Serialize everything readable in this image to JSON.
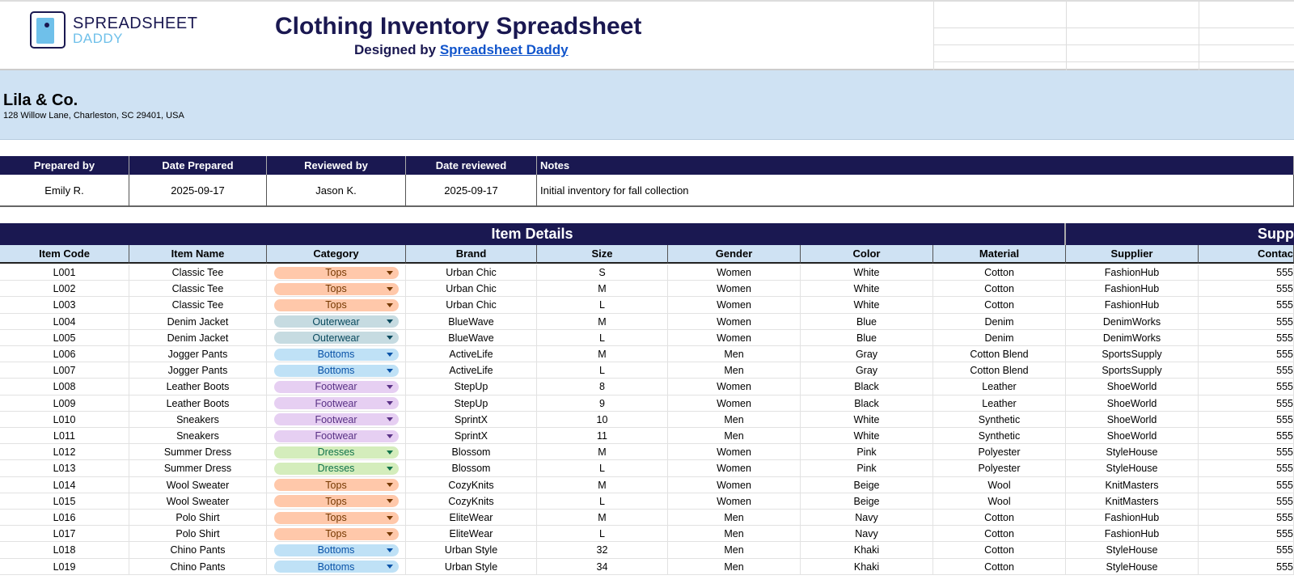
{
  "header": {
    "brand_line1": "SPREADSHEET",
    "brand_line2": "DADDY",
    "title": "Clothing Inventory Spreadsheet",
    "designed_by": "Designed by",
    "designer_link": "Spreadsheet Daddy"
  },
  "company": {
    "name": "Lila & Co.",
    "address": "128 Willow Lane, Charleston, SC 29401, USA"
  },
  "info": {
    "headers": [
      "Prepared by",
      "Date Prepared",
      "Reviewed by",
      "Date reviewed",
      "Notes"
    ],
    "values": [
      "Emily R.",
      "2025-09-17",
      "Jason K.",
      "2025-09-17",
      "Initial inventory for fall collection"
    ]
  },
  "sections": {
    "item_details": "Item Details",
    "supplier": "Supp"
  },
  "columns": [
    "Item Code",
    "Item Name",
    "Category",
    "Brand",
    "Size",
    "Gender",
    "Color",
    "Material",
    "Supplier",
    "Contac"
  ],
  "category_colors": {
    "Tops": [
      "#ffc8aa",
      "#753800"
    ],
    "Outerwear": [
      "#c6dbe1",
      "#0a4a5e"
    ],
    "Bottoms": [
      "#bfe1f6",
      "#0a53a8"
    ],
    "Footwear": [
      "#e6cff2",
      "#5a3286"
    ],
    "Dresses": [
      "#d4edbc",
      "#11734b"
    ]
  },
  "rows": [
    [
      "L001",
      "Classic Tee",
      "Tops",
      "Urban Chic",
      "S",
      "Women",
      "White",
      "Cotton",
      "FashionHub",
      "555"
    ],
    [
      "L002",
      "Classic Tee",
      "Tops",
      "Urban Chic",
      "M",
      "Women",
      "White",
      "Cotton",
      "FashionHub",
      "555"
    ],
    [
      "L003",
      "Classic Tee",
      "Tops",
      "Urban Chic",
      "L",
      "Women",
      "White",
      "Cotton",
      "FashionHub",
      "555"
    ],
    [
      "L004",
      "Denim Jacket",
      "Outerwear",
      "BlueWave",
      "M",
      "Women",
      "Blue",
      "Denim",
      "DenimWorks",
      "555"
    ],
    [
      "L005",
      "Denim Jacket",
      "Outerwear",
      "BlueWave",
      "L",
      "Women",
      "Blue",
      "Denim",
      "DenimWorks",
      "555"
    ],
    [
      "L006",
      "Jogger Pants",
      "Bottoms",
      "ActiveLife",
      "M",
      "Men",
      "Gray",
      "Cotton Blend",
      "SportsSupply",
      "555"
    ],
    [
      "L007",
      "Jogger Pants",
      "Bottoms",
      "ActiveLife",
      "L",
      "Men",
      "Gray",
      "Cotton Blend",
      "SportsSupply",
      "555"
    ],
    [
      "L008",
      "Leather Boots",
      "Footwear",
      "StepUp",
      "8",
      "Women",
      "Black",
      "Leather",
      "ShoeWorld",
      "555"
    ],
    [
      "L009",
      "Leather Boots",
      "Footwear",
      "StepUp",
      "9",
      "Women",
      "Black",
      "Leather",
      "ShoeWorld",
      "555"
    ],
    [
      "L010",
      "Sneakers",
      "Footwear",
      "SprintX",
      "10",
      "Men",
      "White",
      "Synthetic",
      "ShoeWorld",
      "555"
    ],
    [
      "L011",
      "Sneakers",
      "Footwear",
      "SprintX",
      "11",
      "Men",
      "White",
      "Synthetic",
      "ShoeWorld",
      "555"
    ],
    [
      "L012",
      "Summer Dress",
      "Dresses",
      "Blossom",
      "M",
      "Women",
      "Pink",
      "Polyester",
      "StyleHouse",
      "555"
    ],
    [
      "L013",
      "Summer Dress",
      "Dresses",
      "Blossom",
      "L",
      "Women",
      "Pink",
      "Polyester",
      "StyleHouse",
      "555"
    ],
    [
      "L014",
      "Wool Sweater",
      "Tops",
      "CozyKnits",
      "M",
      "Women",
      "Beige",
      "Wool",
      "KnitMasters",
      "555"
    ],
    [
      "L015",
      "Wool Sweater",
      "Tops",
      "CozyKnits",
      "L",
      "Women",
      "Beige",
      "Wool",
      "KnitMasters",
      "555"
    ],
    [
      "L016",
      "Polo Shirt",
      "Tops",
      "EliteWear",
      "M",
      "Men",
      "Navy",
      "Cotton",
      "FashionHub",
      "555"
    ],
    [
      "L017",
      "Polo Shirt",
      "Tops",
      "EliteWear",
      "L",
      "Men",
      "Navy",
      "Cotton",
      "FashionHub",
      "555"
    ],
    [
      "L018",
      "Chino Pants",
      "Bottoms",
      "Urban Style",
      "32",
      "Men",
      "Khaki",
      "Cotton",
      "StyleHouse",
      "555"
    ],
    [
      "L019",
      "Chino Pants",
      "Bottoms",
      "Urban Style",
      "34",
      "Men",
      "Khaki",
      "Cotton",
      "StyleHouse",
      "555"
    ]
  ]
}
